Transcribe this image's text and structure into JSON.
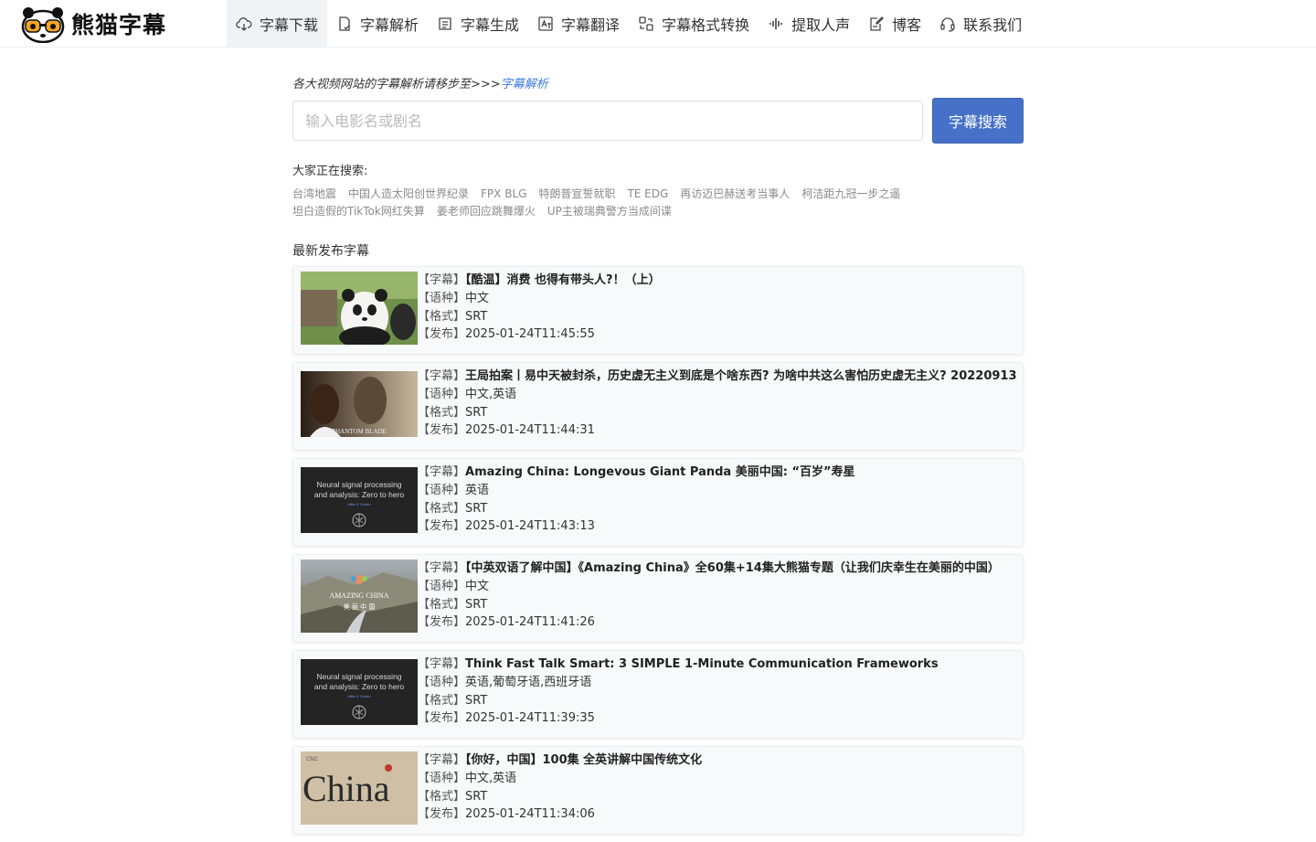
{
  "brand": {
    "name": "熊猫字幕"
  },
  "nav": [
    {
      "label": "字幕下载",
      "icon": "cloud-download-icon",
      "active": true
    },
    {
      "label": "字幕解析",
      "icon": "file-parse-icon",
      "active": false
    },
    {
      "label": "字幕生成",
      "icon": "file-generate-icon",
      "active": false
    },
    {
      "label": "字幕翻译",
      "icon": "translate-icon",
      "active": false
    },
    {
      "label": "字幕格式转换",
      "icon": "format-convert-icon",
      "active": false
    },
    {
      "label": "提取人声",
      "icon": "audio-wave-icon",
      "active": false
    },
    {
      "label": "博客",
      "icon": "blog-edit-icon",
      "active": false
    },
    {
      "label": "联系我们",
      "icon": "headset-icon",
      "active": false
    }
  ],
  "hint": {
    "prefix": "各大视频网站的字幕解析请移步至>>>",
    "link": "字幕解析"
  },
  "search": {
    "placeholder": "输入电影名或剧名",
    "value": "",
    "button": "字幕搜索"
  },
  "hot": {
    "label": "大家正在搜索:",
    "items": [
      "台湾地震",
      "中国人造太阳创世界纪录",
      "FPX BLG",
      "特朗普宣誓就职",
      "TE EDG",
      "再访迈巴赫送考当事人",
      "柯洁距九冠一步之遥",
      "坦白造假的TikTok网红失算",
      "姜老师回应跳舞爆火",
      "UP主被瑞典警方当成间谍"
    ]
  },
  "latest": {
    "title": "最新发布字幕",
    "keys": {
      "subtitle": "【字幕】",
      "lang": "【语种】",
      "format": "【格式】",
      "published": "【发布】"
    },
    "items": [
      {
        "title": "【酷温】消费 也得有带头人?！（上）",
        "lang": "中文",
        "format": "SRT",
        "published": "2025-01-24T11:45:55",
        "thumb": "panda"
      },
      {
        "title": "王局拍案丨易中天被封杀，历史虚无主义到底是个啥东西? 为啥中共这么害怕历史虚无主义? 20220913",
        "lang": "中文,英语",
        "format": "SRT",
        "published": "2025-01-24T11:44:31",
        "thumb": "phantom"
      },
      {
        "title": "Amazing China: Longevous Giant Panda 美丽中国: “百岁”寿星",
        "lang": "英语",
        "format": "SRT",
        "published": "2025-01-24T11:43:13",
        "thumb": "neural"
      },
      {
        "title": "【中英双语了解中国】《Amazing China》全60集+14集大熊猫专题（让我们庆幸生在美丽的中国）",
        "lang": "中文",
        "format": "SRT",
        "published": "2025-01-24T11:41:26",
        "thumb": "amazing"
      },
      {
        "title": "Think Fast Talk Smart: 3 SIMPLE 1-Minute Communication Frameworks",
        "lang": "英语,葡萄牙语,西班牙语",
        "format": "SRT",
        "published": "2025-01-24T11:39:35",
        "thumb": "neural"
      },
      {
        "title": "【你好，中国】100集 全英讲解中国传统文化",
        "lang": "中文,英语",
        "format": "SRT",
        "published": "2025-01-24T11:34:06",
        "thumb": "china"
      }
    ]
  },
  "thumb_text": {
    "neural_line1": "Neural signal processing",
    "neural_line2": "and analysis: Zero to hero",
    "neural_author": "Mike X Cohen",
    "phantom": "PHANTOM BLADE",
    "amazing_en": "AMAZING CHINA",
    "amazing_cn": "美 丽 中 国",
    "china_big": "China",
    "china_small": "CNC"
  },
  "colors": {
    "accent": "#4771c8",
    "link": "#3b7be0",
    "card_bg": "#f8f9fb",
    "hot_text": "#8a8a8a"
  }
}
